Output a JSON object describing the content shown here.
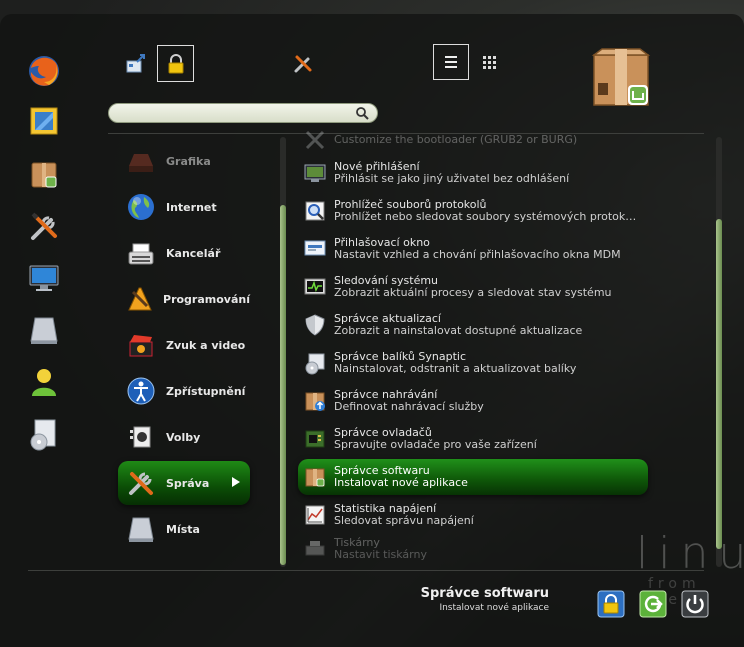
{
  "favorites": [
    {
      "name": "firefox-icon"
    },
    {
      "name": "mail-icon"
    },
    {
      "name": "software-manager-icon"
    },
    {
      "name": "system-tools-icon"
    },
    {
      "name": "monitor-icon"
    },
    {
      "name": "drive-icon"
    },
    {
      "name": "user-icon"
    },
    {
      "name": "disc-icon"
    }
  ],
  "search": {
    "value": "",
    "placeholder": ""
  },
  "categories": [
    {
      "label": "Grafika"
    },
    {
      "label": "Internet"
    },
    {
      "label": "Kancelář"
    },
    {
      "label": "Programování"
    },
    {
      "label": "Zvuk a video"
    },
    {
      "label": "Zpřístupnění"
    },
    {
      "label": "Volby"
    },
    {
      "label": "Správa"
    },
    {
      "label": "Místa"
    }
  ],
  "apps": [
    {
      "name": "Customize the bootloader (GRUB2 or BURG)",
      "desc": ""
    },
    {
      "name": "Nové přihlášení",
      "desc": "Přihlásit se jako jiný uživatel bez odhlášení"
    },
    {
      "name": "Prohlížeč souborů protokolů",
      "desc": "Prohlížet nebo sledovat soubory systémových protok…"
    },
    {
      "name": "Přihlašovací okno",
      "desc": "Nastavit vzhled a chování přihlašovacího okna MDM"
    },
    {
      "name": "Sledování systému",
      "desc": "Zobrazit aktuální procesy a sledovat stav systému"
    },
    {
      "name": "Správce aktualizací",
      "desc": "Zobrazit a nainstalovat dostupné aktualizace"
    },
    {
      "name": "Správce balíků Synaptic",
      "desc": "Nainstalovat, odstranit a aktualizovat balíky"
    },
    {
      "name": "Správce nahrávání",
      "desc": "Definovat nahrávací služby"
    },
    {
      "name": "Správce ovladačů",
      "desc": "Spravujte ovladače pro vaše zařízení"
    },
    {
      "name": "Správce softwaru",
      "desc": "Instalovat nové aplikace"
    },
    {
      "name": "Statistika napájení",
      "desc": "Sledovat správu napájení"
    },
    {
      "name": "Tiskárny",
      "desc": "Nastavit tiskárny"
    }
  ],
  "selected": {
    "name": "Správce softwaru",
    "desc": "Instalovat nové aplikace"
  },
  "watermark": {
    "line1": "linu",
    "line2": "from fre"
  }
}
